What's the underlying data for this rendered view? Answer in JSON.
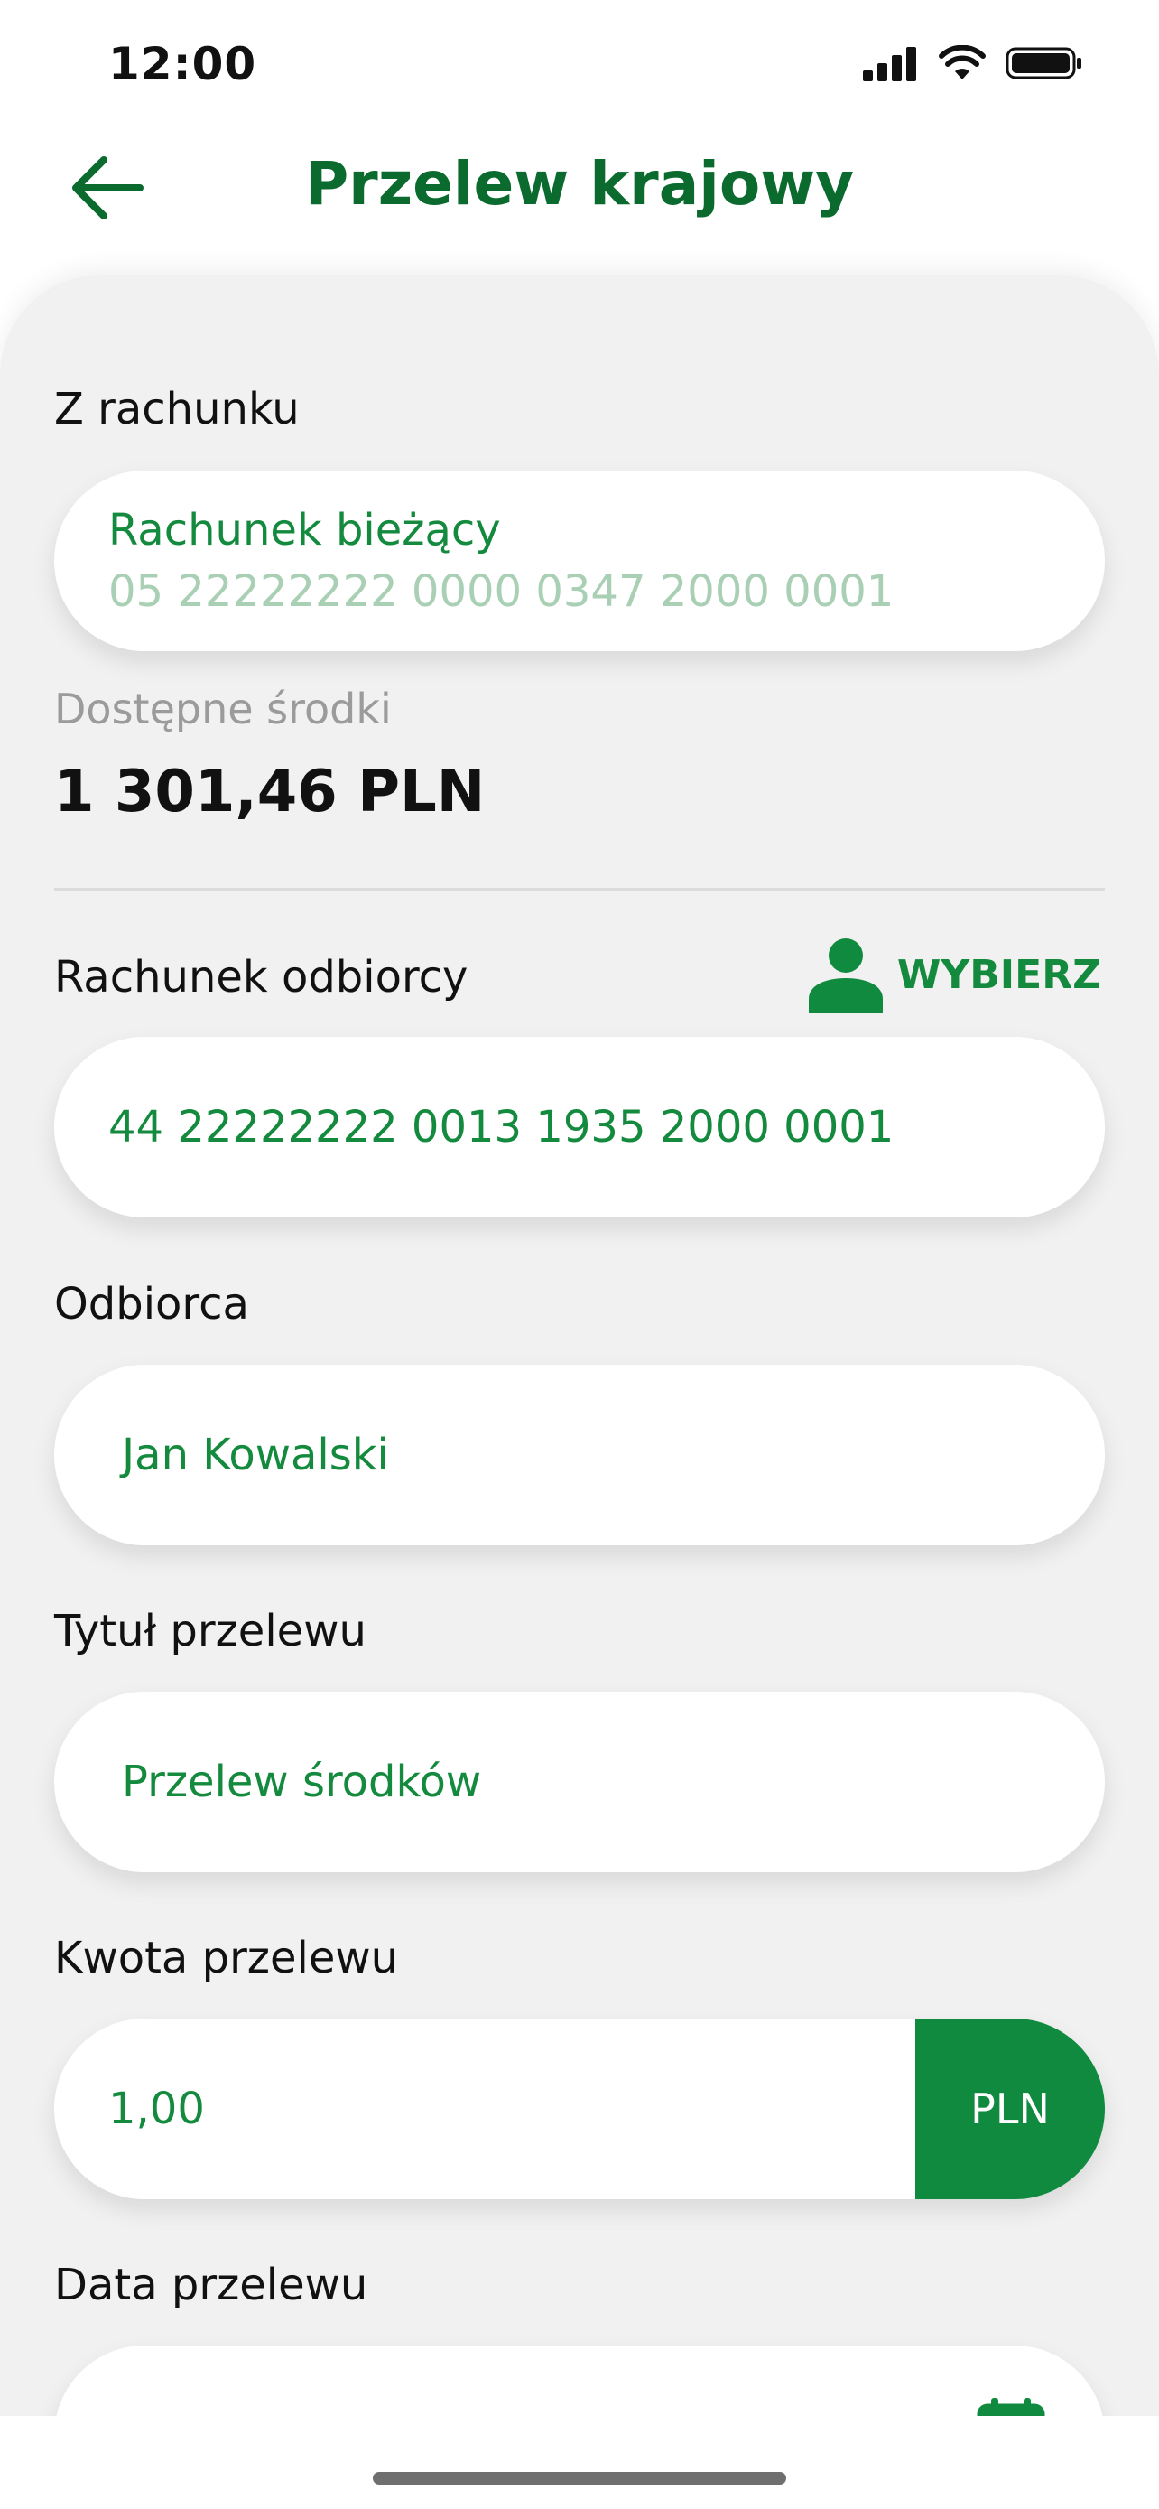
{
  "status": {
    "time": "12:00"
  },
  "header": {
    "title": "Przelew krajowy",
    "back_icon": "arrow-left-icon"
  },
  "from": {
    "label": "Z rachunku",
    "account_name": "Rachunek bieżący",
    "account_number": "05 22222222 0000 0347 2000 0001"
  },
  "available": {
    "label": "Dostępne środki",
    "amount": "1 301,46 PLN"
  },
  "recipient_account": {
    "label": "Rachunek odbiorcy",
    "choose_label": "WYBIERZ",
    "value": "44 22222222 0013 1935 2000 0001"
  },
  "recipient": {
    "label": "Odbiorca",
    "value": "Jan Kowalski"
  },
  "title_field": {
    "label": "Tytuł przelewu",
    "value": "Przelew środków"
  },
  "amount": {
    "label": "Kwota przelewu",
    "value": "1,00",
    "currency": "PLN"
  },
  "date": {
    "label": "Data przelewu"
  },
  "colors": {
    "brand_green": "#0f8a3e",
    "title_green": "#0b6b2f",
    "text_green": "#138a3d"
  }
}
